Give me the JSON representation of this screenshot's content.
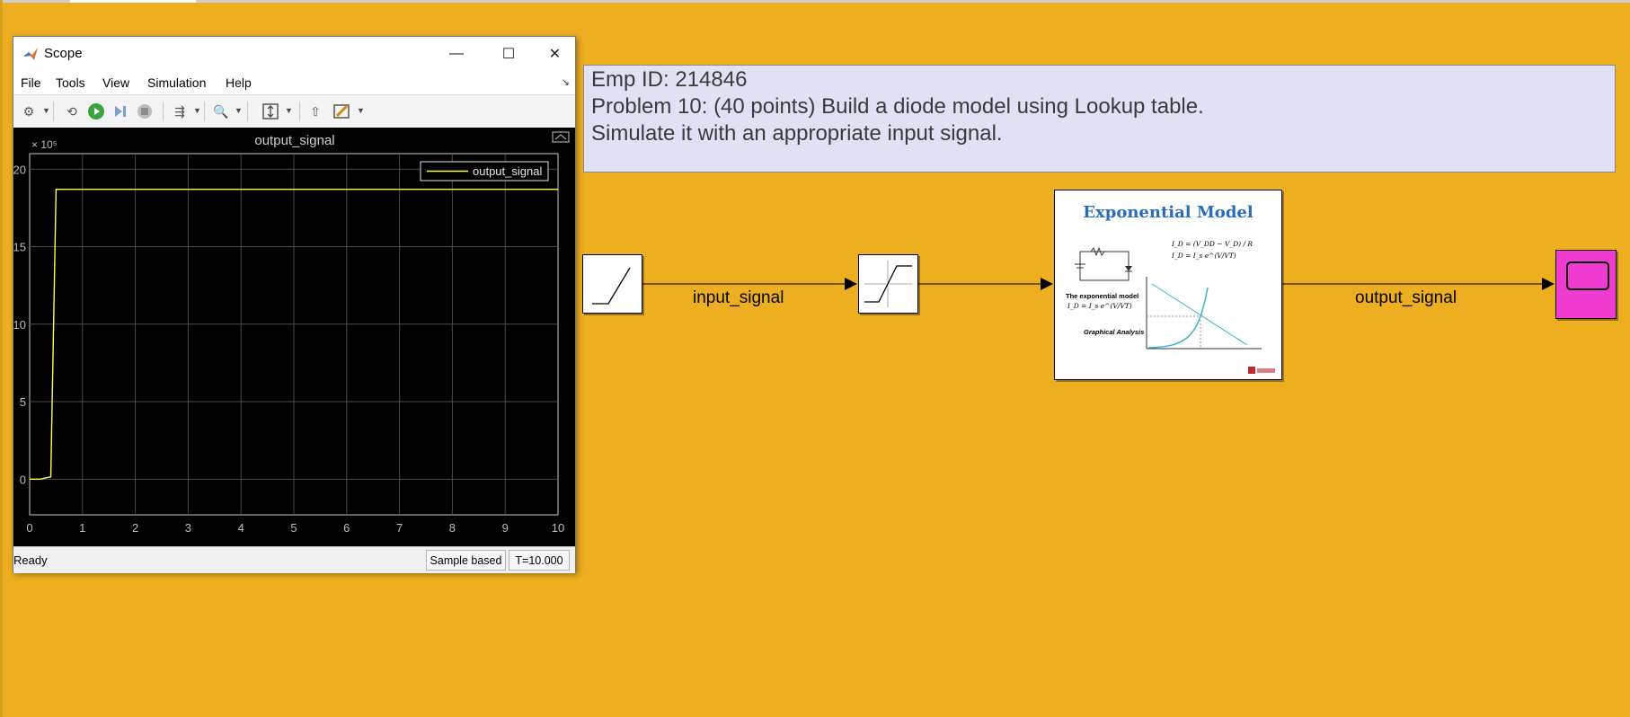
{
  "window": {
    "title": "Scope",
    "minimize_glyph": "—",
    "maximize_glyph": "☐",
    "close_glyph": "✕"
  },
  "menu": [
    "File",
    "Tools",
    "View",
    "Simulation",
    "Help"
  ],
  "toolbar_icons": [
    "settings-icon",
    "restore-icon",
    "run-icon",
    "step-forward-icon",
    "stop-icon",
    "highlight-icon",
    "zoom-icon",
    "scale-axes-icon",
    "triggers-icon",
    "measurements-icon"
  ],
  "status": {
    "state": "Ready",
    "mode": "Sample based",
    "time": "T=10.000"
  },
  "annotation": {
    "line1": "Emp ID: 214846",
    "line2": "Problem 10: (40 points) Build a diode model using Lookup table.",
    "line3": "Simulate it with an appropriate input signal."
  },
  "model": {
    "input_label": "input_signal",
    "output_label": "output_signal",
    "lut": {
      "title": "Exponential Model",
      "eq1": "I_D = (V_DD − V_D) / R",
      "eq2": "I_D = I_s e^(V/VT)",
      "text1": "The exponential model",
      "text2": "I_D = I_s e^(V/VT)",
      "text3": "Graphical Analysis"
    }
  },
  "colors": {
    "background": "#EDAE1F",
    "annotation_bg": "#E0E1F5",
    "scope_block": "#F03BD0",
    "trace": "#FFFF4D"
  },
  "chart_data": {
    "type": "line",
    "title": "output_signal",
    "exponent_label": "× 10⁵",
    "legend": [
      "output_signal"
    ],
    "legend_position": "top-right",
    "xlim": [
      0,
      10
    ],
    "ylim": [
      -2.3,
      21
    ],
    "xticks": [
      "0",
      "1",
      "2",
      "3",
      "4",
      "5",
      "6",
      "7",
      "8",
      "9",
      "10"
    ],
    "yticks": [
      "0",
      "5",
      "10",
      "15",
      "20"
    ],
    "grid": true,
    "series": [
      {
        "name": "output_signal",
        "x": [
          0,
          0.2,
          0.4,
          0.5,
          10
        ],
        "y": [
          0,
          0,
          0.15,
          18.7,
          18.7
        ]
      }
    ]
  }
}
